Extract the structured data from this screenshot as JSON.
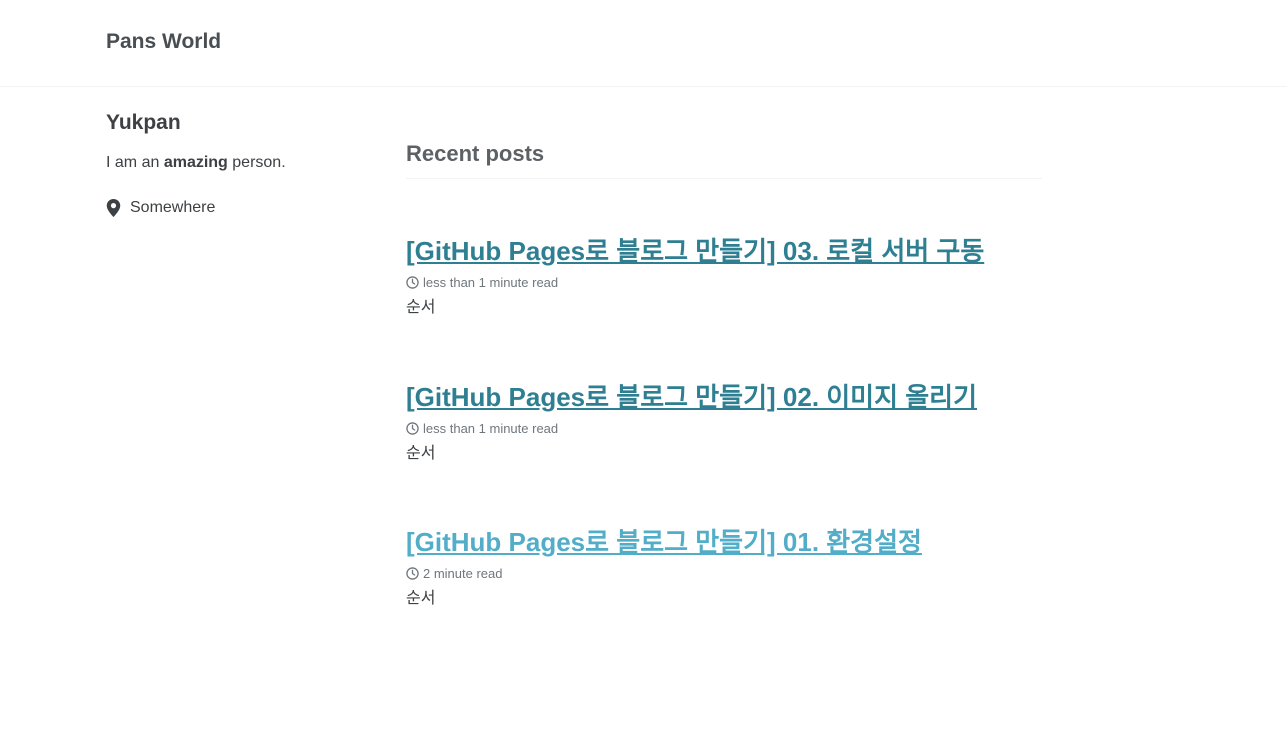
{
  "header": {
    "site_title": "Pans World"
  },
  "author": {
    "name": "Yukpan",
    "bio_before": "I am an ",
    "bio_emphasis": "amazing",
    "bio_after": " person.",
    "location_icon": "map-marker-icon",
    "location": "Somewhere"
  },
  "main": {
    "section_title": "Recent posts",
    "posts": [
      {
        "title": "[GitHub Pages로 블로그 만들기] 03. 로컬 서버 구동",
        "read_time": "less than 1 minute read",
        "excerpt": "순서"
      },
      {
        "title": "[GitHub Pages로 블로그 만들기] 02. 이미지 올리기",
        "read_time": "less than 1 minute read",
        "excerpt": "순서"
      },
      {
        "title": "[GitHub Pages로 블로그 만들기] 01. 환경설정",
        "read_time": "2 minute read",
        "excerpt": "순서"
      }
    ]
  },
  "colors": {
    "link": "#2f7f93",
    "link_hover": "#52adc8",
    "text": "#3d4144",
    "meta": "#6f777d"
  }
}
